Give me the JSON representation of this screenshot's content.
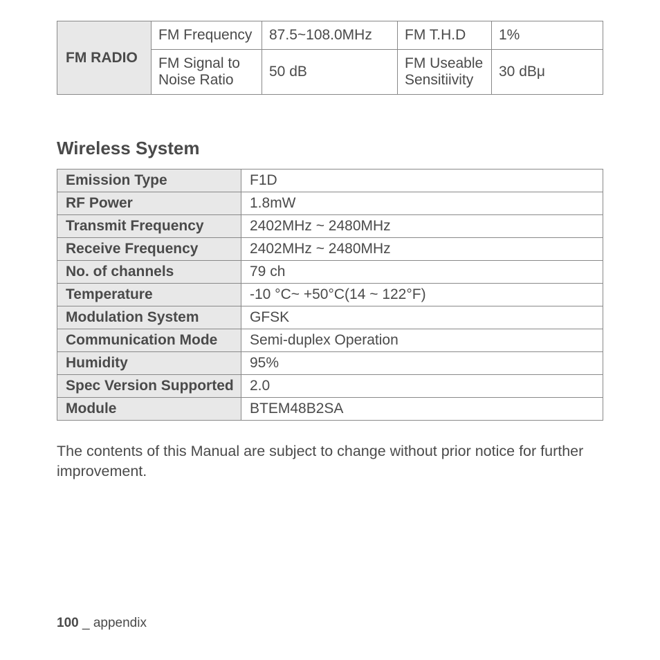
{
  "fm_radio": {
    "header": "FM RADIO",
    "rows": [
      {
        "l1": "FM Frequency",
        "v1": "87.5~108.0MHz",
        "l2": "FM T.H.D",
        "v2": "1%"
      },
      {
        "l1": "FM Signal to Noise Ratio",
        "v1": "50 dB",
        "l2": "FM Useable Sensitiivity",
        "v2": "30 dBμ"
      }
    ]
  },
  "wireless": {
    "title": "Wireless System",
    "rows": [
      {
        "label": "Emission Type",
        "value": "F1D"
      },
      {
        "label": "RF Power",
        "value": "1.8mW"
      },
      {
        "label": "Transmit Frequency",
        "value": "2402MHz ~ 2480MHz"
      },
      {
        "label": "Receive Frequency",
        "value": "2402MHz ~ 2480MHz"
      },
      {
        "label": "No. of channels",
        "value": "79 ch"
      },
      {
        "label": "Temperature",
        "value": "-10 °C~ +50°C(14 ~ 122°F)"
      },
      {
        "label": "Modulation System",
        "value": "GFSK"
      },
      {
        "label": "Communication Mode",
        "value": "Semi-duplex Operation"
      },
      {
        "label": "Humidity",
        "value": "95%"
      },
      {
        "label": "Spec Version Supported",
        "value": "2.0"
      },
      {
        "label": "Module",
        "value": "BTEM48B2SA"
      }
    ]
  },
  "note": "The contents of this Manual are subject to change without prior notice for further improvement.",
  "footer": {
    "page": "100",
    "sep": " _ ",
    "section": "appendix"
  }
}
